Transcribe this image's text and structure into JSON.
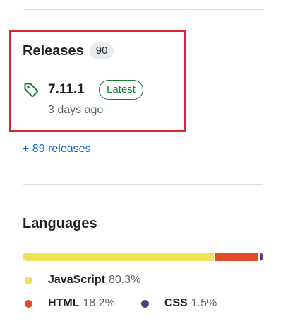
{
  "releases": {
    "title": "Releases",
    "count": "90",
    "latest": {
      "version": "7.11.1",
      "badge": "Latest",
      "date": "3 days ago",
      "icon": "tag-icon"
    },
    "more_link": "+ 89 releases"
  },
  "languages": {
    "title": "Languages",
    "items": [
      {
        "name": "JavaScript",
        "percent": "80.3%",
        "value": 80.3,
        "color": "#f1e05a"
      },
      {
        "name": "HTML",
        "percent": "18.2%",
        "value": 18.2,
        "color": "#e34c26"
      },
      {
        "name": "CSS",
        "percent": "1.5%",
        "value": 1.5,
        "color": "#563d7c"
      }
    ]
  },
  "colors": {
    "highlight": "#d7262e",
    "link": "#0969da",
    "latest_badge": "#1a7f37"
  }
}
